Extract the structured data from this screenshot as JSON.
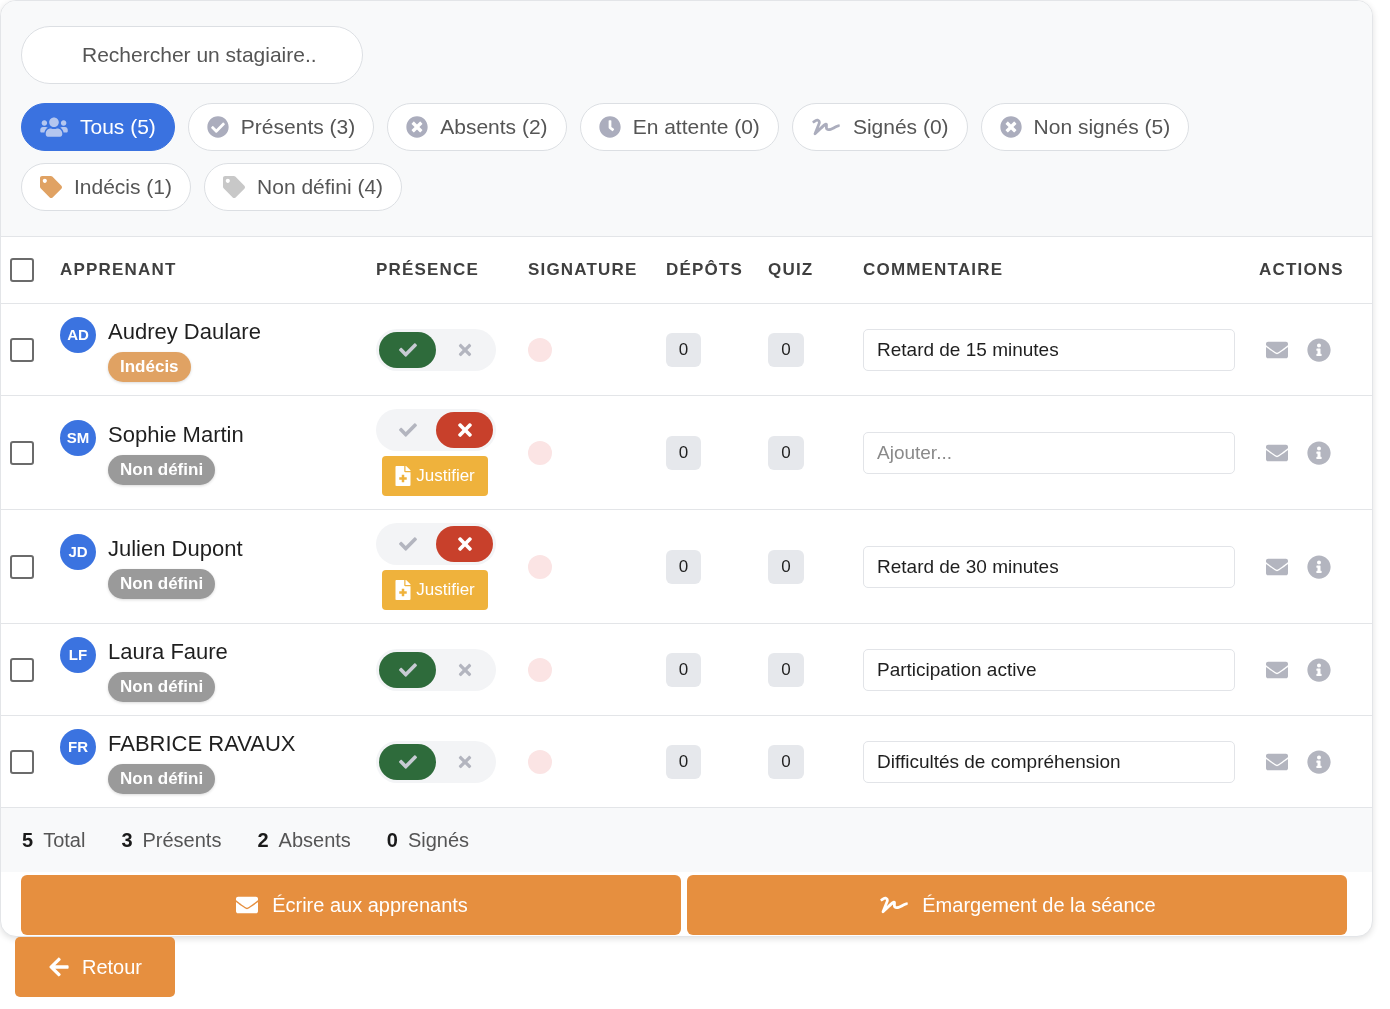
{
  "search": {
    "placeholder": "Rechercher un stagiaire.."
  },
  "filters": [
    {
      "kind": "users",
      "label": "Tous (5)",
      "selected": true
    },
    {
      "kind": "check",
      "label": "Présents (3)",
      "selected": false
    },
    {
      "kind": "cross",
      "label": "Absents (2)",
      "selected": false
    },
    {
      "kind": "clock",
      "label": "En attente (0)",
      "selected": false
    },
    {
      "kind": "signature",
      "label": "Signés (0)",
      "selected": false
    },
    {
      "kind": "cross",
      "label": "Non signés (5)",
      "selected": false
    },
    {
      "kind": "tag",
      "label": "Indécis (1)",
      "selected": false,
      "color": "#e0a263"
    },
    {
      "kind": "tag",
      "label": "Non défini (4)",
      "selected": false,
      "color": "#c8c8c8"
    }
  ],
  "table": {
    "select_all": {
      "checked": false
    },
    "columns": [
      "APPRENANT",
      "PRÉSENCE",
      "SIGNATURE",
      "DÉPÔTS",
      "QUIZ",
      "COMMENTAIRE",
      "ACTIONS"
    ],
    "rows": [
      {
        "checked": false,
        "initials": "AD",
        "name": "Audrey Daulare",
        "status": {
          "label": "Indécis",
          "color": "#e0a263"
        },
        "present": true,
        "signed": false,
        "depots": "0",
        "quiz": "0",
        "comment": {
          "value": "Retard de 15 minutes"
        }
      },
      {
        "checked": false,
        "initials": "SM",
        "name": "Sophie Martin",
        "status": {
          "label": "Non défini",
          "color": "#9a9a9a"
        },
        "present": false,
        "justify": "Justifier",
        "signed": false,
        "depots": "0",
        "quiz": "0",
        "comment": {
          "placeholder": "Ajouter..."
        }
      },
      {
        "checked": false,
        "initials": "JD",
        "name": "Julien Dupont",
        "status": {
          "label": "Non défini",
          "color": "#9a9a9a"
        },
        "present": false,
        "justify": "Justifier",
        "signed": false,
        "depots": "0",
        "quiz": "0",
        "comment": {
          "value": "Retard de 30 minutes"
        }
      },
      {
        "checked": false,
        "initials": "LF",
        "name": "Laura Faure",
        "status": {
          "label": "Non défini",
          "color": "#9a9a9a"
        },
        "present": true,
        "signed": false,
        "depots": "0",
        "quiz": "0",
        "comment": {
          "value": "Participation active"
        }
      },
      {
        "checked": false,
        "initials": "FR",
        "name": "FABRICE RAVAUX",
        "status": {
          "label": "Non défini",
          "color": "#9a9a9a"
        },
        "present": true,
        "signed": false,
        "depots": "0",
        "quiz": "0",
        "comment": {
          "value": "Difficultés de compréhension"
        }
      }
    ]
  },
  "summary": [
    {
      "count": "5",
      "label": "Total"
    },
    {
      "count": "3",
      "label": "Présents"
    },
    {
      "count": "2",
      "label": "Absents"
    },
    {
      "count": "0",
      "label": "Signés"
    }
  ],
  "footer_buttons": [
    {
      "kind": "mail",
      "label": "Écrire aux apprenants"
    },
    {
      "kind": "signature",
      "label": "Émargement de la séance"
    }
  ],
  "back_button": {
    "label": "Retour"
  }
}
